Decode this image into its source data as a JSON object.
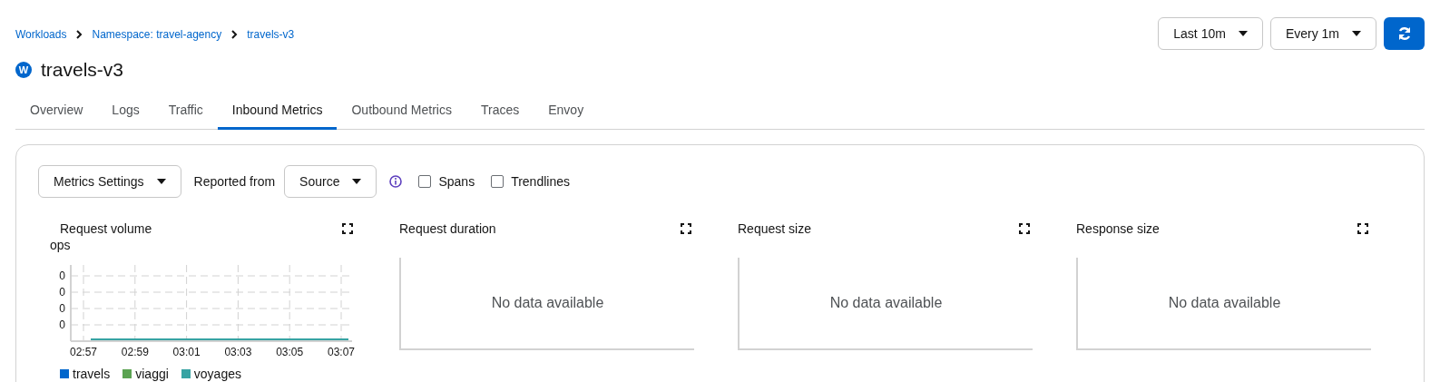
{
  "breadcrumb": [
    {
      "label": "Workloads"
    },
    {
      "label": "Namespace: travel-agency"
    },
    {
      "label": "travels-v3"
    }
  ],
  "title": {
    "badge": "W",
    "text": "travels-v3"
  },
  "time_controls": {
    "range": "Last 10m",
    "refresh_interval": "Every 1m"
  },
  "tabs": [
    {
      "label": "Overview",
      "selected": false
    },
    {
      "label": "Logs",
      "selected": false
    },
    {
      "label": "Traffic",
      "selected": false
    },
    {
      "label": "Inbound Metrics",
      "selected": true
    },
    {
      "label": "Outbound Metrics",
      "selected": false
    },
    {
      "label": "Traces",
      "selected": false
    },
    {
      "label": "Envoy",
      "selected": false
    }
  ],
  "toolbar": {
    "metrics_settings": "Metrics Settings",
    "reported_from_label": "Reported from",
    "reported_from": "Source",
    "checkboxes": [
      {
        "label": "Spans",
        "checked": false
      },
      {
        "label": "Trendlines",
        "checked": false
      }
    ]
  },
  "charts": [
    {
      "kind": "chart",
      "title": "Request volume",
      "unit": "ops",
      "y_tick_labels": [
        "0",
        "0",
        "0",
        "0"
      ],
      "x_tick_labels": [
        "02:57",
        "02:59",
        "03:01",
        "03:03",
        "03:05",
        "03:07"
      ],
      "legend": [
        {
          "name": "travels",
          "color": "#0066cc"
        },
        {
          "name": "viaggi",
          "color": "#5ba352"
        },
        {
          "name": "voyages",
          "color": "#37a3a3"
        }
      ]
    },
    {
      "kind": "empty",
      "title": "Request duration",
      "message": "No data available"
    },
    {
      "kind": "empty",
      "title": "Request size",
      "message": "No data available"
    },
    {
      "kind": "empty",
      "title": "Response size",
      "message": "No data available"
    }
  ]
}
